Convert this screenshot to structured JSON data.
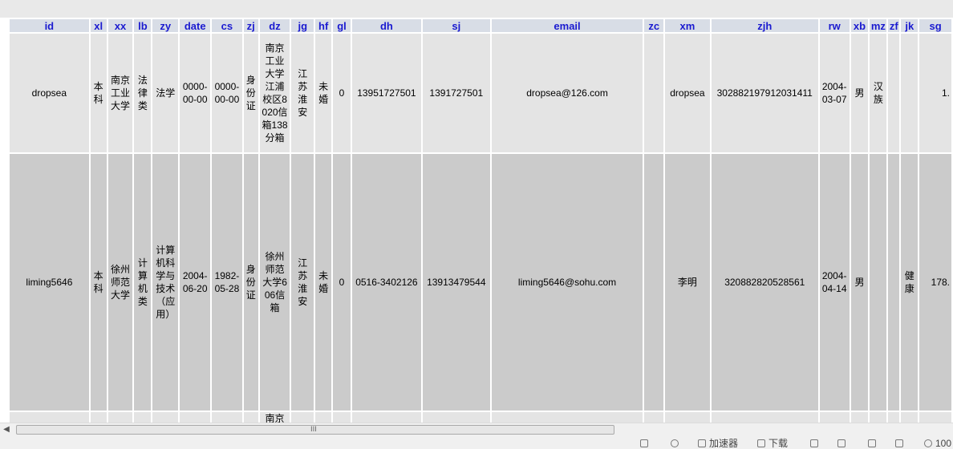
{
  "columns": [
    "id",
    "xl",
    "xx",
    "lb",
    "zy",
    "date",
    "cs",
    "zj",
    "dz",
    "jg",
    "hf",
    "gl",
    "dh",
    "sj",
    "email",
    "zc",
    "xm",
    "zjh",
    "rw",
    "xb",
    "mz",
    "zf",
    "jk",
    "sg"
  ],
  "rows": [
    {
      "id": "dropsea",
      "xl": "本科",
      "xx": "南京工业大学",
      "lb": "法律类",
      "zy": "法学",
      "date": "0000-00-00",
      "cs": "0000-00-00",
      "zj": "身份证",
      "dz": "南京工业大学江浦校区8020信箱138分箱",
      "jg": "江苏淮安",
      "hf": "未婚",
      "gl": "0",
      "dh": "13951727501",
      "sj": "1391727501",
      "email": "dropsea@126.com",
      "zc": "",
      "xm": "dropsea",
      "zjh": "302882197912031411",
      "rw": "2004-03-07",
      "xb": "男",
      "mz": "汉族",
      "zf": "",
      "jk": "",
      "sg": "1."
    },
    {
      "id": "liming5646",
      "xl": "本科",
      "xx": "徐州师范大学",
      "lb": "计算机类",
      "zy": "计算机科学与技术（应用）",
      "date": "2004-06-20",
      "cs": "1982-05-28",
      "zj": "身份证",
      "dz": "徐州师范大学606信箱",
      "jg": "江苏淮安",
      "hf": "未婚",
      "gl": "0",
      "dh": "0516-3402126",
      "sj": "13913479544",
      "email": "liming5646@sohu.com",
      "zc": "",
      "xm": "李明",
      "zjh": "320882820528561",
      "rw": "2004-04-14",
      "xb": "男",
      "mz": "",
      "zf": "",
      "jk": "健康",
      "sg": "178."
    },
    {
      "id": "",
      "xl": "",
      "xx": "",
      "lb": "",
      "zy": "",
      "date": "",
      "cs": "",
      "zj": "",
      "dz": "南京",
      "jg": "",
      "hf": "",
      "gl": "",
      "dh": "",
      "sj": "",
      "email": "",
      "zc": "",
      "xm": "",
      "zjh": "",
      "rw": "",
      "xb": "",
      "mz": "",
      "zf": "",
      "jk": "",
      "sg": ""
    }
  ],
  "scrollbar": {
    "grip": "III"
  },
  "statusbar": {
    "items": [
      "加速器",
      "下载",
      "100"
    ]
  }
}
